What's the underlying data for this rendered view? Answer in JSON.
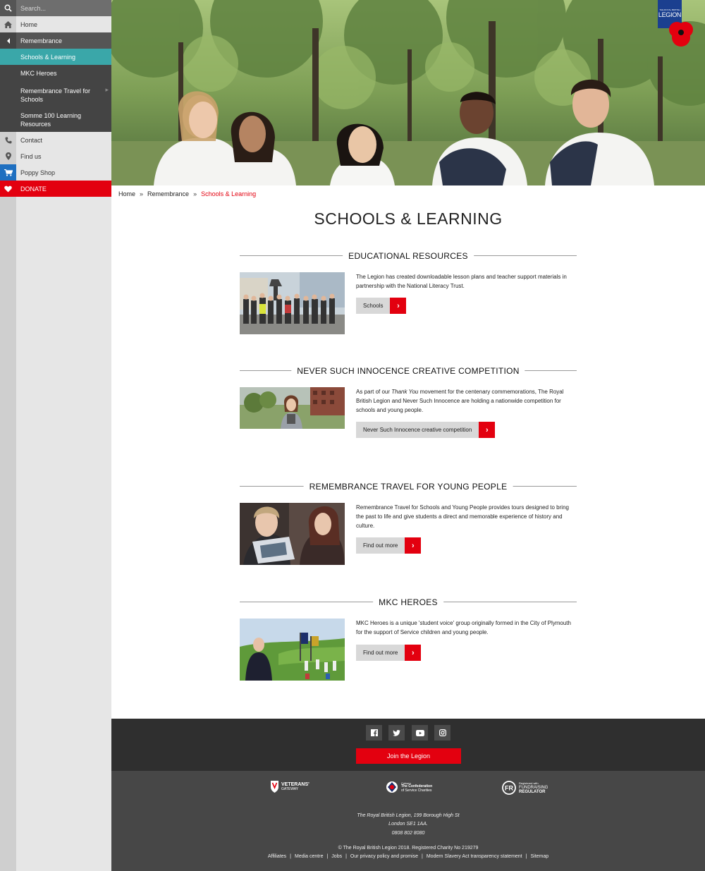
{
  "sidebar": {
    "search_placeholder": "Search...",
    "home": "Home",
    "remembrance": "Remembrance",
    "sub_items": [
      "Schools & Learning",
      "MKC Heroes",
      "Remembrance Travel for Schools",
      "Somme 100 Learning Resources"
    ],
    "contact": "Contact",
    "find_us": "Find us",
    "poppy_shop": "Poppy Shop",
    "donate": "DONATE"
  },
  "logo": {
    "small": "THE ROYAL BRITISH",
    "name": "LEGION"
  },
  "breadcrumb": {
    "home": "Home",
    "remembrance": "Remembrance",
    "current": "Schools & Learning"
  },
  "page_title": "SCHOOLS & LEARNING",
  "sections": [
    {
      "title": "EDUCATIONAL RESOURCES",
      "desc": "The Legion has created downloadable lesson plans and teacher support materials in partnership with the National Literacy Trust.",
      "button": "Schools"
    },
    {
      "title": "NEVER SUCH INNOCENCE CREATIVE COMPETITION",
      "desc_before": "As part of our ",
      "desc_em": "Thank You",
      "desc_after": " movement for the centenary commemorations, The Royal British Legion and Never Such Innocence are holding a nationwide competition for schools and young people.",
      "button": "Never Such Innocence creative competition"
    },
    {
      "title": "REMEMBRANCE TRAVEL FOR YOUNG PEOPLE",
      "desc": "Remembrance Travel for Schools and Young People provides tours designed to bring the past to life and give students a direct and memorable experience of history and culture.",
      "button": "Find out more"
    },
    {
      "title": "MKC HEROES",
      "desc": "MKC Heroes is a unique 'student voice' group originally formed in the City of Plymouth for the support of Service children and young people.",
      "button": "Find out more"
    }
  ],
  "footer": {
    "join": "Join the Legion",
    "partners": {
      "veterans": {
        "name": "VETERANS'",
        "sub": "GATEWAY"
      },
      "cobseo": {
        "small": "Cobseo",
        "name": "The Confederation",
        "sub": "of Service Charities"
      },
      "regulator": {
        "small": "Registered with",
        "name": "FUNDRAISING",
        "sub": "REGULATOR"
      }
    },
    "address": [
      "The Royal British Legion, 199 Borough High St",
      "London SE1 1AA.",
      "0808 802 8080"
    ],
    "copyright": "© The Royal British Legion 2018. Registered Charity No 219279",
    "links": [
      "Affiliates",
      "Media centre",
      "Jobs",
      "Our privacy policy and promise",
      "Modern Slavery Act transparency statement",
      "Sitemap"
    ]
  },
  "colors": {
    "accent": "#e3000f",
    "teal": "#3aa7a9",
    "shop_blue": "#1e6fc0",
    "footer_dark": "#2f2f2f"
  },
  "icons": [
    "search-icon",
    "home-icon",
    "chevron-left-icon",
    "phone-icon",
    "map-pin-icon",
    "cart-icon",
    "heart-icon",
    "chevron-right-icon",
    "facebook-icon",
    "twitter-icon",
    "youtube-icon",
    "instagram-icon",
    "poppy-icon"
  ]
}
